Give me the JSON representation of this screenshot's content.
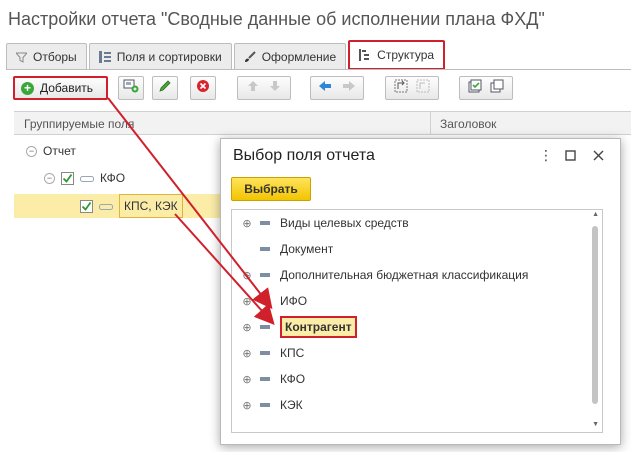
{
  "window": {
    "title": "Настройки отчета \"Сводные данные об исполнении плана ФХД\""
  },
  "tabs": [
    {
      "label": "Отборы",
      "icon": "filter-icon"
    },
    {
      "label": "Поля и сортировки",
      "icon": "fields-icon"
    },
    {
      "label": "Оформление",
      "icon": "brush-icon"
    },
    {
      "label": "Структура",
      "icon": "structure-icon"
    }
  ],
  "toolbar": {
    "add_label": "Добавить"
  },
  "grid": {
    "col_grouped": "Группируемые поля",
    "col_header": "Заголовок",
    "rows": [
      "Отчет",
      "КФО",
      "КПС, КЭК"
    ]
  },
  "dialog": {
    "title": "Выбор поля отчета",
    "choose_label": "Выбрать",
    "items": [
      "Виды целевых средств",
      "Документ",
      "Дополнительная бюджетная классификация",
      "ИФО",
      "Контрагент",
      "КПС",
      "КФО",
      "КЭК"
    ]
  },
  "colors": {
    "accent_red": "#d0202c",
    "highlight_yellow": "#fbeda8",
    "button_yellow": "#f2c400"
  }
}
